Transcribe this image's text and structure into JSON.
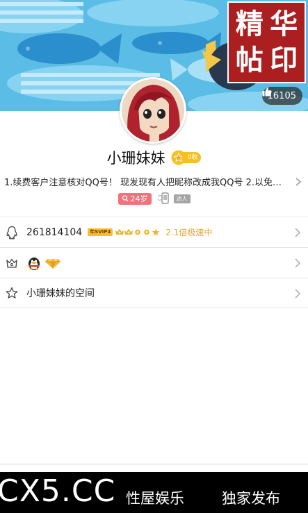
{
  "cover": {
    "seal_chars": [
      "精",
      "华",
      "帖",
      "印"
    ],
    "like_count": "16105"
  },
  "profile": {
    "nickname": "小珊妹妹",
    "vip_tag": "0收",
    "signature": "1.续费客户注意核对QQ号！ 现发现有人把昵称改成我QQ号 2.以免费...",
    "age": "24岁",
    "talent_label": "达人"
  },
  "list": {
    "qq_number": "261814104",
    "svip_label": "年SVIP4",
    "speed_text": "2.1倍极速中",
    "space_label": "小珊妹妹的空间"
  },
  "banner": {
    "site": "CX5.CC",
    "left_text": "性屋娱乐",
    "right_text": "独家发布"
  },
  "colors": {
    "sky": "#4fb3de",
    "seal_red": "#ac1f21",
    "gold": "#f6c022",
    "age_pink": "#f1727d",
    "speed_orange": "#e8a32a"
  }
}
